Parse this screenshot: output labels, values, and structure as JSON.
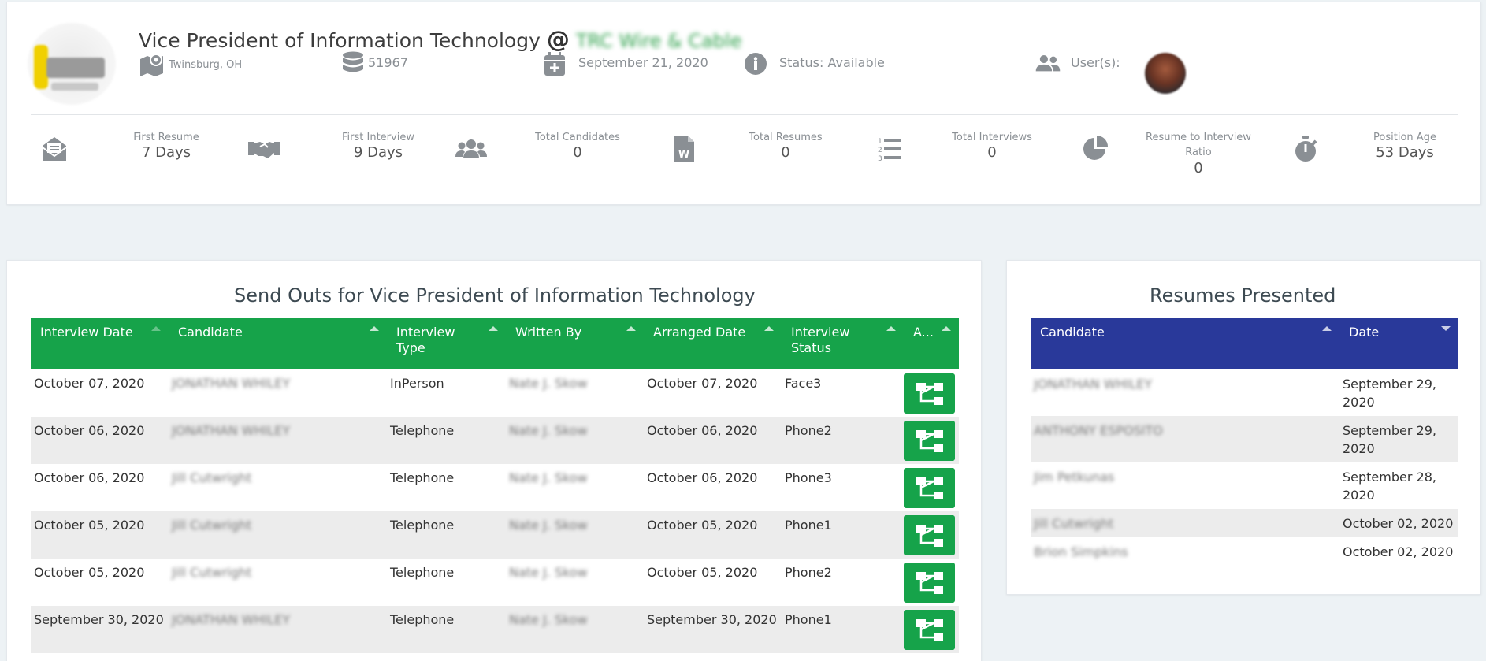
{
  "header": {
    "job_title": "Vice President of Information Technology",
    "at_symbol": "@",
    "company": "TRC Wire & Cable",
    "location": "Twinsburg, OH",
    "job_id": "51967",
    "date": "September 21, 2020",
    "status": "Status: Available",
    "users_label": "User(s):"
  },
  "stats": [
    {
      "label": "First Resume",
      "value": "7 Days",
      "icon": "envelope-open-icon"
    },
    {
      "label": "First Interview",
      "value": "9 Days",
      "icon": "handshake-icon"
    },
    {
      "label": "Total Candidates",
      "value": "0",
      "icon": "users-icon"
    },
    {
      "label": "Total Resumes",
      "value": "0",
      "icon": "word-file-icon"
    },
    {
      "label": "Total Interviews",
      "value": "0",
      "icon": "numbered-list-icon"
    },
    {
      "label": "Resume to Interview Ratio",
      "value": "0",
      "icon": "pie-chart-icon"
    },
    {
      "label": "Position Age",
      "value": "53 Days",
      "icon": "stopwatch-icon"
    }
  ],
  "sendouts": {
    "title": "Send Outs for Vice President of Information Technology",
    "columns": [
      "Interview Date",
      "Candidate",
      "Interview Type",
      "Written By",
      "Arranged Date",
      "Interview Status",
      "A..."
    ],
    "rows": [
      {
        "interview_date": "October 07, 2020",
        "candidate": "JONATHAN WHILEY",
        "type": "InPerson",
        "written_by": "Nate J. Skow",
        "arranged_date": "October 07, 2020",
        "status": "Face3"
      },
      {
        "interview_date": "October 06, 2020",
        "candidate": "JONATHAN WHILEY",
        "type": "Telephone",
        "written_by": "Nate J. Skow",
        "arranged_date": "October 06, 2020",
        "status": "Phone2"
      },
      {
        "interview_date": "October 06, 2020",
        "candidate": "Jill Cutwright",
        "type": "Telephone",
        "written_by": "Nate J. Skow",
        "arranged_date": "October 06, 2020",
        "status": "Phone3"
      },
      {
        "interview_date": "October 05, 2020",
        "candidate": "Jill Cutwright",
        "type": "Telephone",
        "written_by": "Nate J. Skow",
        "arranged_date": "October 05, 2020",
        "status": "Phone1"
      },
      {
        "interview_date": "October 05, 2020",
        "candidate": "Jill Cutwright",
        "type": "Telephone",
        "written_by": "Nate J. Skow",
        "arranged_date": "October 05, 2020",
        "status": "Phone2"
      },
      {
        "interview_date": "September 30, 2020",
        "candidate": "JONATHAN WHILEY",
        "type": "Telephone",
        "written_by": "Nate J. Skow",
        "arranged_date": "September 30, 2020",
        "status": "Phone1"
      }
    ]
  },
  "resumes": {
    "title": "Resumes Presented",
    "columns": [
      "Candidate",
      "Date"
    ],
    "rows": [
      {
        "candidate": "JONATHAN WHILEY",
        "date": "September 29, 2020"
      },
      {
        "candidate": "ANTHONY ESPOSITO",
        "date": "September 29, 2020"
      },
      {
        "candidate": "Jim Petkunas",
        "date": "September 28, 2020"
      },
      {
        "candidate": "Jill Cutwright",
        "date": "October 02, 2020"
      },
      {
        "candidate": "Brion Simpkins",
        "date": "October 02, 2020"
      }
    ]
  },
  "colors": {
    "table_green": "#16a34a",
    "table_blue": "#29399a",
    "icon_gray": "#8a8f94"
  }
}
